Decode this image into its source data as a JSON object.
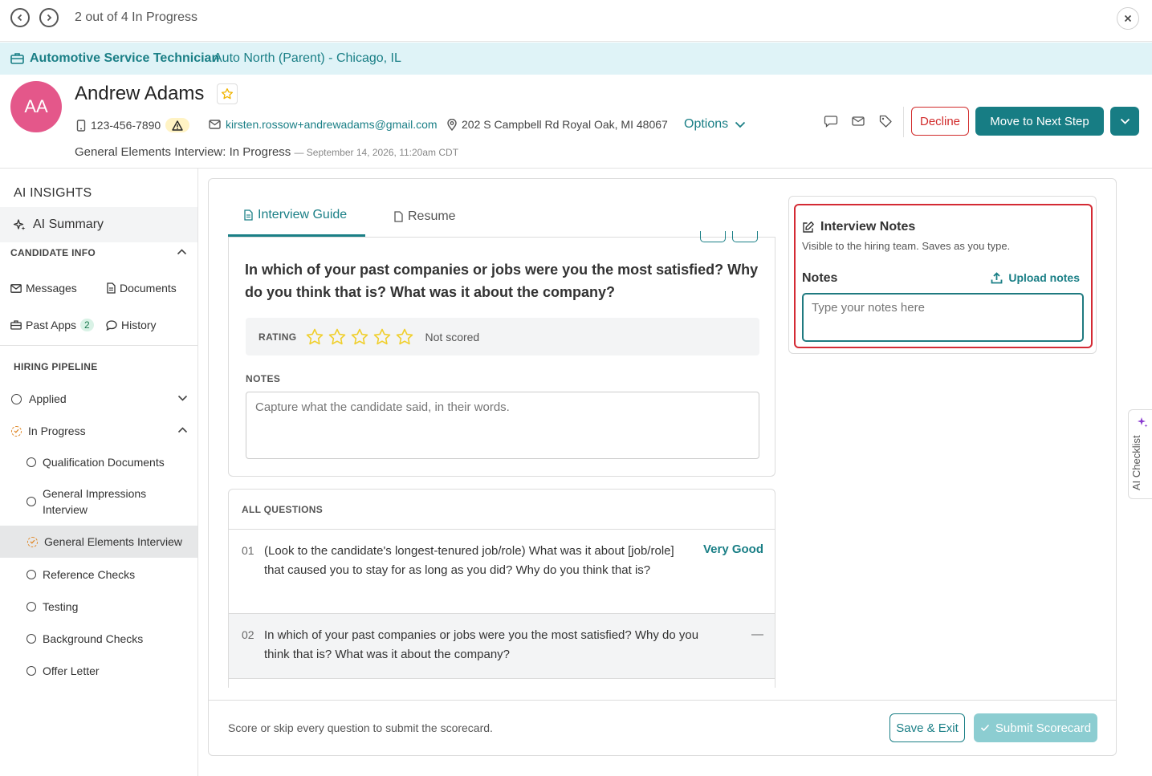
{
  "nav": {
    "progress": "2 out of 4 In Progress"
  },
  "job": {
    "title": "Automotive Service Technician",
    "location": "Auto North (Parent) - Chicago, IL"
  },
  "candidate": {
    "initials": "AA",
    "name": "Andrew Adams",
    "phone": "123-456-7890",
    "email": "kirsten.rossow+andrewadams@gmail.com",
    "address": "202 S Campbell Rd Royal Oak, MI 48067",
    "options_label": "Options",
    "stage": "General Elements Interview: In Progress",
    "stage_timestamp": "— September 14, 2026, 11:20am CDT"
  },
  "actions": {
    "decline": "Decline",
    "next_step": "Move to Next Step"
  },
  "sidebar": {
    "ai_heading": "AI INSIGHTS",
    "ai_summary": "AI Summary",
    "candidate_info": "CANDIDATE INFO",
    "messages": "Messages",
    "documents": "Documents",
    "past_apps": "Past Apps",
    "past_apps_count": "2",
    "history": "History",
    "hiring_pipeline": "HIRING PIPELINE",
    "pipeline": [
      {
        "label": "Applied"
      },
      {
        "label": "In Progress"
      },
      {
        "label": "Qualification Documents"
      },
      {
        "label": "General Impressions Interview"
      },
      {
        "label": "General Elements Interview"
      },
      {
        "label": "Reference Checks"
      },
      {
        "label": "Testing"
      },
      {
        "label": "Background Checks"
      },
      {
        "label": "Offer Letter"
      }
    ]
  },
  "tabs": {
    "guide": "Interview Guide",
    "resume": "Resume"
  },
  "question": {
    "text": "In which of your past companies or jobs were you the most satisfied? Why do you think that is? What was it about the company?",
    "rating_label": "RATING",
    "rating_status": "Not scored",
    "rating_value": 0,
    "notes_label": "NOTES",
    "notes_placeholder": "Capture what the candidate said, in their words."
  },
  "all_questions": {
    "heading": "ALL QUESTIONS",
    "items": [
      {
        "num": "01",
        "text": "(Look to the candidate's longest-tenured job/role) What was it about [job/role] that caused you to stay for as long as you did? Why do you think that is?",
        "score": "Very Good"
      },
      {
        "num": "02",
        "text": "In which of your past companies or jobs were you the most satisfied? Why do you think that is? What was it about the company?",
        "score": "—"
      }
    ]
  },
  "footer": {
    "hint": "Score or skip every question to submit the scorecard.",
    "save_exit": "Save & Exit",
    "submit": "Submit Scorecard"
  },
  "interview_notes": {
    "title": "Interview Notes",
    "subtitle": "Visible to the hiring team. Saves as you type.",
    "notes_label": "Notes",
    "upload": "Upload notes",
    "placeholder": "Type your notes here"
  },
  "ai_checklist": "AI Checklist",
  "colors": {
    "teal": "#177d84",
    "decline_red": "#d12b2b",
    "avatar_pink": "#e4578a",
    "banner_bg": "#dff3f7",
    "highlight_red": "#d42a34"
  }
}
